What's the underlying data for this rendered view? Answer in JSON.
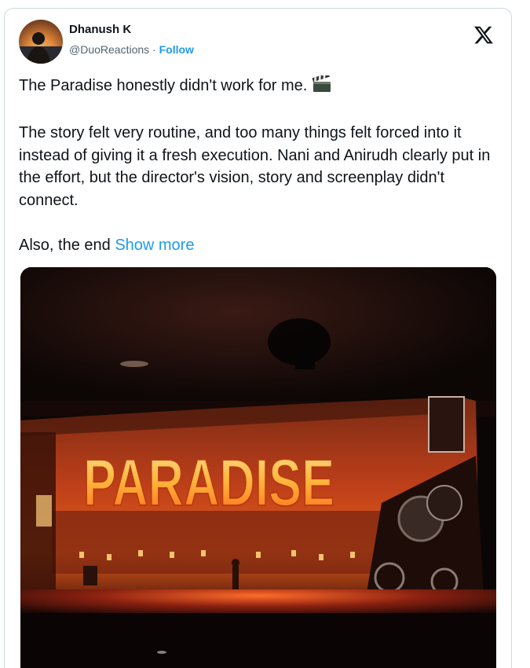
{
  "tweet": {
    "author_name": "Dhanush K",
    "handle": "@DuoReactions",
    "separator": "·",
    "follow_label": "Follow",
    "paragraph1": "The Paradise honestly didn't work for me.",
    "paragraph2": "The story felt very routine, and too many things felt forced into it instead of giving it a fresh execution. Nani and Anirudh clearly put in the effort, but the director's vision, story and screenplay didn't connect.",
    "paragraph3": "Also, the end",
    "show_more_label": "Show more",
    "emoji": "clapper-board-icon"
  },
  "media": {
    "screen_title": "PARADISE"
  },
  "colors": {
    "link": "#1d9bf0",
    "text": "#0f1419",
    "secondary": "#536471",
    "border": "#cfd9de"
  }
}
